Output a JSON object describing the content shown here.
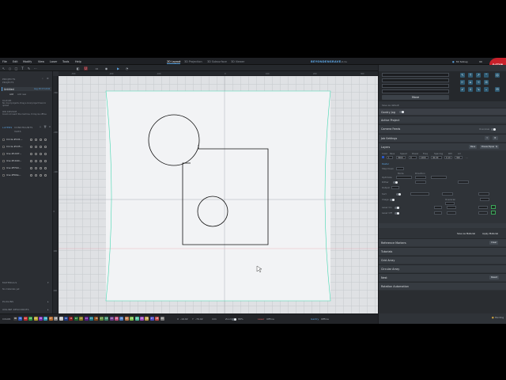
{
  "menubar": {
    "items": [
      "File",
      "Edit",
      "Modify",
      "View",
      "Laser",
      "Tools",
      "Help"
    ],
    "tabs": [
      {
        "label": "2D Layout",
        "active": true
      },
      {
        "label": "3D Projection",
        "active": false
      },
      {
        "label": "3D Subsurface",
        "active": false
      },
      {
        "label": "3D Viewer",
        "active": false
      }
    ],
    "brand": "BEYONDENGRAVE",
    "version": "v4.0a",
    "user": "Mr Sidney",
    "user_badge": "99",
    "estop": "E-STOP"
  },
  "toolbar": {
    "tools": [
      "↖",
      "○",
      "□",
      "T",
      "✎",
      "⋯",
      "◧",
      "U",
      "▭",
      "◉",
      "▶",
      "◔"
    ]
  },
  "left_panel": {
    "projects_title": "PROJECTS",
    "projects_subtitle": "PROJECTS",
    "project_name": "Untitled",
    "project_date": "Aug 18 17:14:04",
    "add_label": "Add",
    "add_new_label": "Add new",
    "cloud_title": "CLOUD",
    "cloud_msg": "No cloud projects. Drag a local project here to upload",
    "on_device_title": "ON DEVICE",
    "on_device_msg": "Could not reach the machine. It may be offline",
    "layers_title": "LAYERS",
    "constraints_title": "CONSTRAINTS",
    "vars_title": "VARS",
    "layers": [
      {
        "name": "Circle #101..."
      },
      {
        "name": "Circle #105..."
      },
      {
        "name": "line #1407..."
      },
      {
        "name": "line #1bb0..."
      },
      {
        "name": "line #f7b0..."
      },
      {
        "name": "line #f00e..."
      }
    ],
    "materials_title": "MATERIALS",
    "materials_msg": "No materials yet",
    "plugins_title": "PLUGINS",
    "resources_title": "ONLINE RESOURCES"
  },
  "rulers": {
    "h": [
      "-300",
      "-200",
      "-100",
      "0",
      "100",
      "200",
      "300"
    ],
    "v": [
      "-300",
      "-200",
      "-100",
      "0",
      "100",
      "200"
    ]
  },
  "statusbar": {
    "color_label": "COLOR",
    "swatches": [
      {
        "label": "00",
        "color": "#3a3a3a"
      },
      {
        "label": "01",
        "color": "#2a56c0"
      },
      {
        "label": "02",
        "color": "#c02a2a"
      },
      {
        "label": "03",
        "color": "#2a9a3a"
      },
      {
        "label": "04",
        "color": "#b8a02a"
      },
      {
        "label": "05",
        "color": "#7a2ab8"
      },
      {
        "label": "06",
        "color": "#2aa0b8"
      },
      {
        "label": "07",
        "color": "#b86a2a"
      },
      {
        "label": "08",
        "color": "#888888"
      },
      {
        "label": "09",
        "color": "#c0c0c0"
      },
      {
        "label": "10",
        "color": "#1a3a8a"
      },
      {
        "label": "11",
        "color": "#8a1a1a"
      },
      {
        "label": "12",
        "color": "#1a6a2a"
      },
      {
        "label": "13",
        "color": "#8a7a1a"
      },
      {
        "label": "14",
        "color": "#5a1a8a"
      },
      {
        "label": "15",
        "color": "#1a7a8a"
      },
      {
        "label": "16",
        "color": "#8a4a1a"
      },
      {
        "label": "17",
        "color": "#5c8a3a"
      },
      {
        "label": "18",
        "color": "#3a8a6a"
      },
      {
        "label": "19",
        "color": "#6a3a8a"
      },
      {
        "label": "20",
        "color": "#c04a7a"
      },
      {
        "label": "21",
        "color": "#4a7ac0"
      },
      {
        "label": "22",
        "color": "#c07a4a"
      },
      {
        "label": "23",
        "color": "#7ac04a"
      },
      {
        "label": "24",
        "color": "#4ac0a0"
      },
      {
        "label": "25",
        "color": "#a04ac0"
      },
      {
        "label": "26",
        "color": "#c0a04a"
      },
      {
        "label": "27",
        "color": "#4a4ac0"
      },
      {
        "label": "28",
        "color": "#c04a4a"
      },
      {
        "label": "29",
        "color": "#7a7a7a"
      }
    ],
    "x_label": "X",
    "x_value": "-19.02",
    "y_label": "Y",
    "y_value": "-79.02",
    "unit": "mm",
    "zoom_label": "Zoom",
    "zoom_value": "88%",
    "laser_label": "Laser",
    "laser_value": "Offline",
    "gantry_label": "Gantry",
    "gantry_value": "Offline",
    "ready": "Pending"
  },
  "right_panel": {
    "move_label": "Move",
    "save_default": "Save as default",
    "jog_title": "Gantry Jog",
    "active_project": "Active Project",
    "camera_feeds": "Camera Feeds",
    "overview": "Overview",
    "job_settings": "Job Settings",
    "layers_head": "Layers",
    "pass_label": "Pass",
    "powerspeed_label": "Power/Speed",
    "cols": [
      "Color",
      "Pass",
      "Speed",
      "Power",
      "Freq",
      "Spacing",
      "DPI",
      "Air"
    ],
    "row_vals": [
      "01",
      "1",
      "3000",
      "0",
      "1000",
      "40.00",
      "0.10",
      "300"
    ],
    "raster_label": "Raster",
    "step_label": "Step Down",
    "mode_label": "Mode",
    "direction_label": "Direction",
    "opt_label": "Optimize",
    "dither_label": "Dither",
    "output_label": "Output",
    "sort_label": "Sort",
    "sort_value": "Inside",
    "image_label": "Image",
    "overscan_label": "Overscan",
    "laser_on_label": "Laser On",
    "laser_off_label": "Laser Off",
    "save_material": "Save as Material",
    "apply_material": "Apply Material",
    "reference_markers": "Reference Markers",
    "reference_btn": "Clear",
    "tutorials": "Tutorials",
    "grid_array": "Grid Array",
    "circular_array": "Circular Array",
    "nest": "Nest",
    "nest_btn": "Reset",
    "rotation_automation": "Rotation Automation"
  }
}
